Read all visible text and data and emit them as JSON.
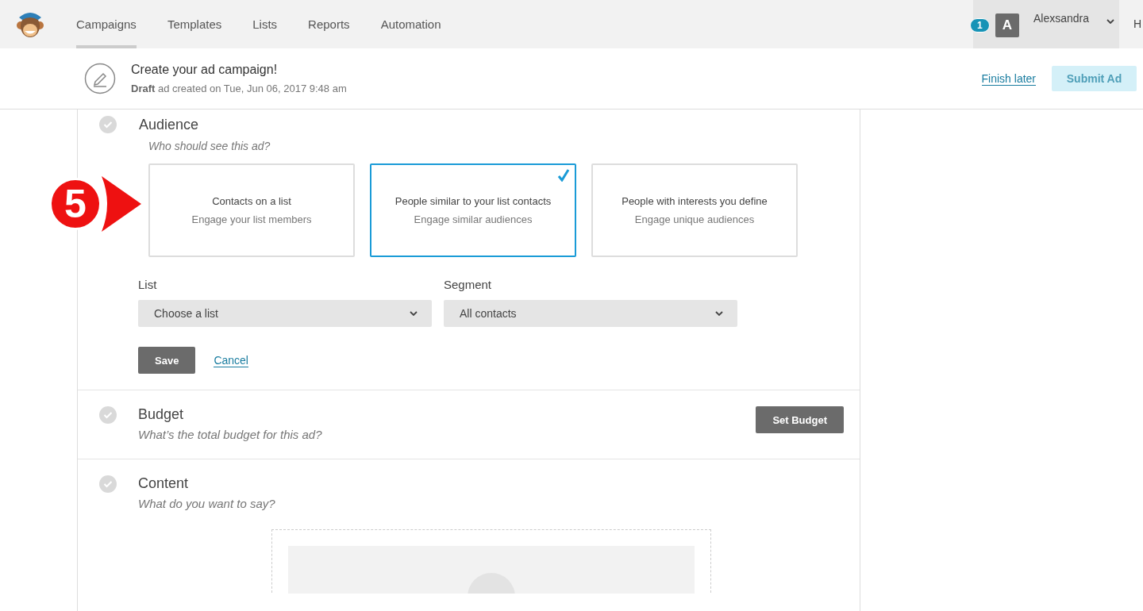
{
  "nav": {
    "tabs": [
      {
        "label": "Campaigns",
        "selected": true
      },
      {
        "label": "Templates",
        "selected": false
      },
      {
        "label": "Lists",
        "selected": false
      },
      {
        "label": "Reports",
        "selected": false
      },
      {
        "label": "Automation",
        "selected": false
      }
    ],
    "user": {
      "badge": "1",
      "initial": "A",
      "name": "Alexsandra"
    },
    "cut_label": "H"
  },
  "header": {
    "title": "Create your ad campaign!",
    "subtitle": "**Draft** ad created on Tue, Jun 06, 2017 9:48 am",
    "finish_later": "Finish later",
    "submit": {
      "label": "Submit Ad",
      "disabled": true
    }
  },
  "annotation": {
    "step": "5"
  },
  "audience": {
    "title": "Audience",
    "question": "Who should see this ad?",
    "options": [
      {
        "title": "Contacts on a list",
        "subtitle": "Engage your list members",
        "selected": false
      },
      {
        "title": "People similar to your list contacts",
        "subtitle": "Engage similar audiences",
        "selected": true
      },
      {
        "title": "People with interests you define",
        "subtitle": "Engage unique audiences",
        "selected": false
      }
    ],
    "fields": [
      {
        "label": "List",
        "value": "Choose a list"
      },
      {
        "label": "Segment",
        "value": "All contacts"
      }
    ],
    "save": "Save",
    "cancel": "Cancel"
  },
  "budget": {
    "title": "Budget",
    "question": "What’s the total budget for this ad?",
    "button": "Set Budget"
  },
  "content": {
    "title": "Content",
    "question": "What do you want to say?"
  }
}
